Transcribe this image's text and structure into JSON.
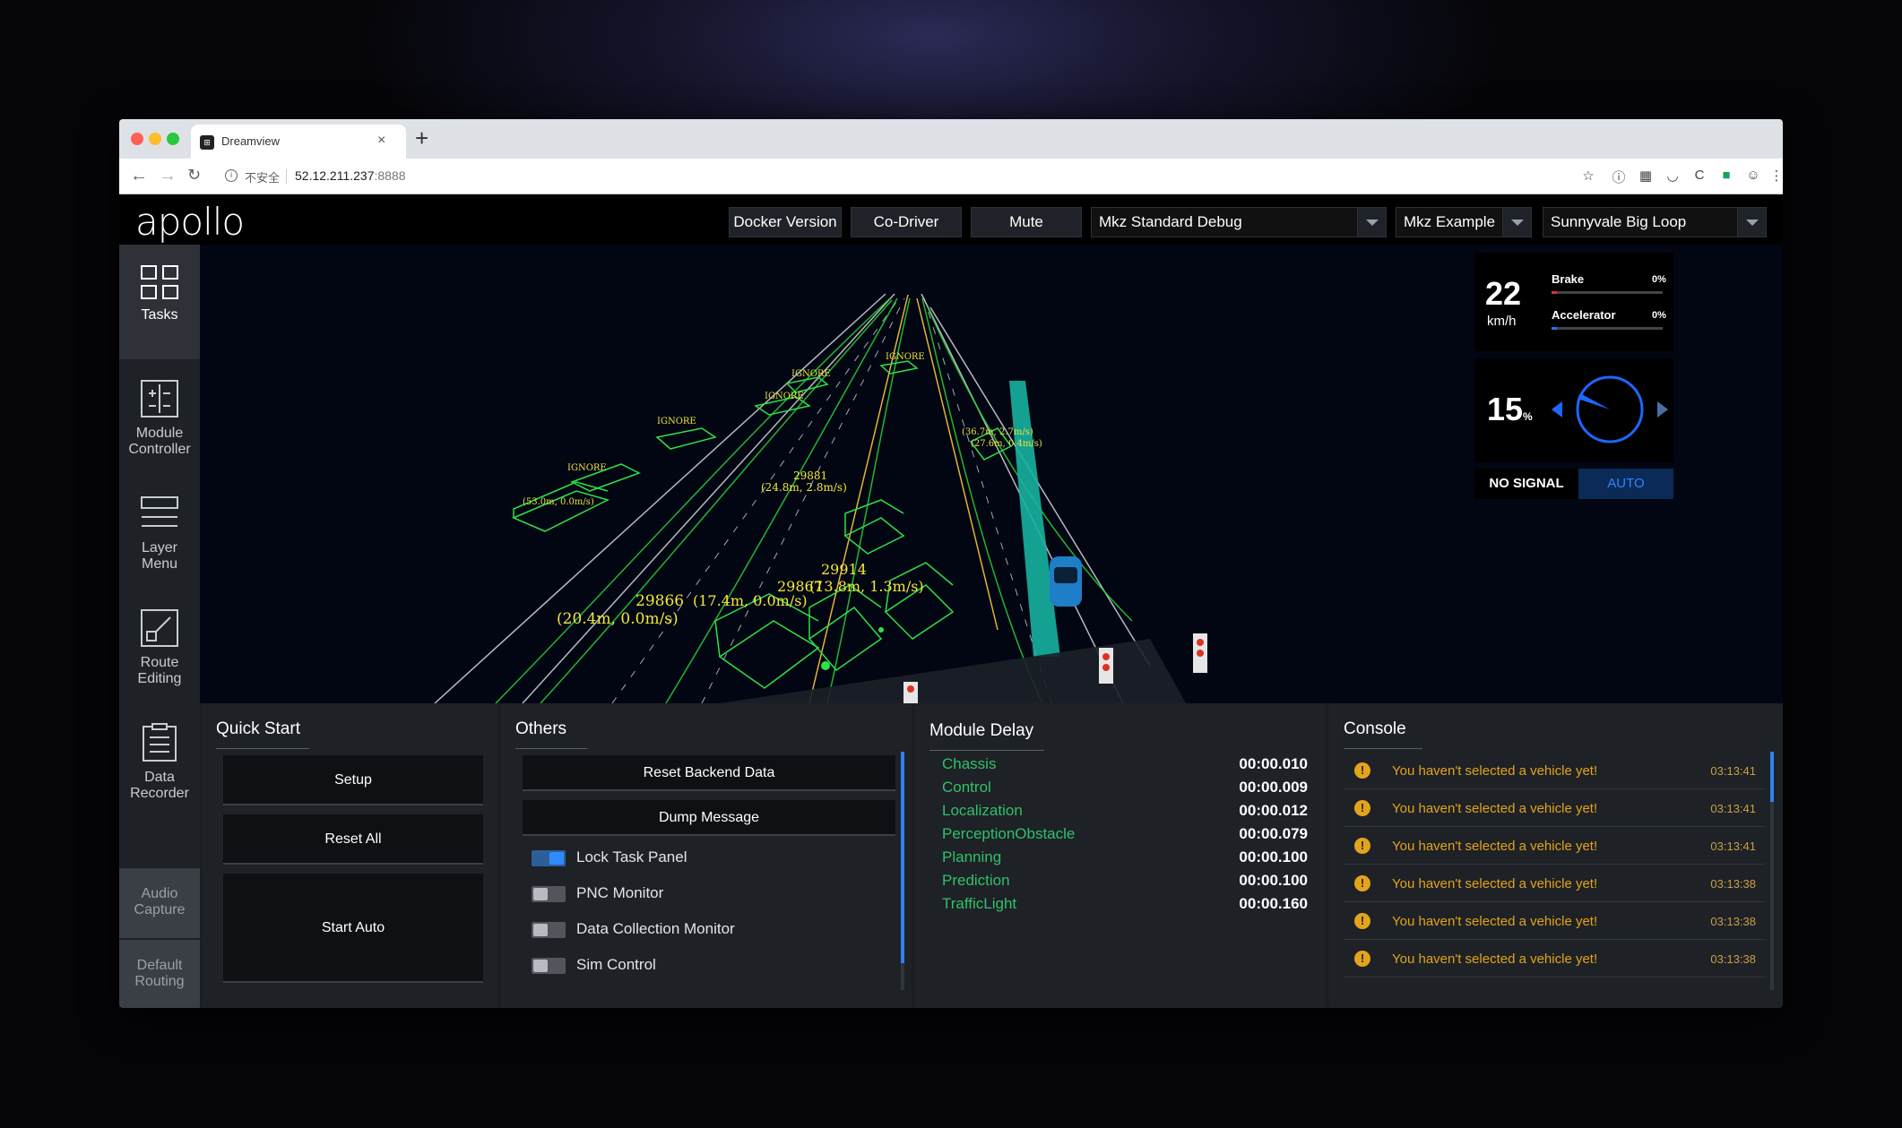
{
  "browser": {
    "tab_title": "Dreamview",
    "tab_favicon": "apollo-favicon",
    "security_label": "不安全",
    "url_host": "52.12.211.237",
    "url_port": ":8888"
  },
  "header": {
    "logo": "apollo",
    "buttons": [
      "Docker Version",
      "Co-Driver",
      "Mute"
    ],
    "mode_select": "Mkz Standard Debug",
    "vehicle_select": "Mkz Example",
    "map_select": "Sunnyvale Big Loop"
  },
  "sidebar": {
    "items": [
      {
        "label_line1": "Tasks",
        "label_line2": "",
        "icon": "grid-icon"
      },
      {
        "label_line1": "Module",
        "label_line2": "Controller",
        "icon": "module-controller-icon"
      },
      {
        "label_line1": "Layer",
        "label_line2": "Menu",
        "icon": "layer-menu-icon"
      },
      {
        "label_line1": "Route",
        "label_line2": "Editing",
        "icon": "route-editing-icon"
      },
      {
        "label_line1": "Data",
        "label_line2": "Recorder",
        "icon": "data-recorder-icon"
      }
    ],
    "footer": [
      {
        "line1": "Audio",
        "line2": "Capture"
      },
      {
        "line1": "Default",
        "line2": "Routing"
      }
    ]
  },
  "dashboard": {
    "speed": "22",
    "speed_unit": "km/h",
    "brake_label": "Brake",
    "brake_value": "0%",
    "brake_level": 0.0,
    "brake_color": "#d9342b",
    "accel_label": "Accelerator",
    "accel_value": "0%",
    "accel_level": 0.0,
    "accel_color": "#2f6dff",
    "steering_value": "15",
    "steering_unit": "%",
    "signal_label": "NO SIGNAL",
    "drive_mode": "AUTO"
  },
  "scene_labels": [
    {
      "id": "29866",
      "text1": "29866",
      "text2": "(20.4m, 0.0m/s)"
    },
    {
      "id": "29867",
      "text1": "29867",
      "text2": "(13.8m, 1.3m/s)"
    },
    {
      "id": "29914",
      "text1": "29914",
      "text2": "(17.4m, 0.0m/s)"
    },
    {
      "id": "29881",
      "text1": "29881",
      "text2": "(24.8m, 2.8m/s)"
    }
  ],
  "quick_start": {
    "title": "Quick Start",
    "buttons": [
      "Setup",
      "Reset All",
      "Start Auto"
    ]
  },
  "others": {
    "title": "Others",
    "buttons": [
      "Reset Backend Data",
      "Dump Message"
    ],
    "toggles": [
      {
        "label": "Lock Task Panel",
        "on": true
      },
      {
        "label": "PNC Monitor",
        "on": false
      },
      {
        "label": "Data Collection Monitor",
        "on": false
      },
      {
        "label": "Sim Control",
        "on": false
      }
    ]
  },
  "module_delay": {
    "title": "Module Delay",
    "rows": [
      {
        "name": "Chassis",
        "value": "00:00.010"
      },
      {
        "name": "Control",
        "value": "00:00.009"
      },
      {
        "name": "Localization",
        "value": "00:00.012"
      },
      {
        "name": "PerceptionObstacle",
        "value": "00:00.079"
      },
      {
        "name": "Planning",
        "value": "00:00.100"
      },
      {
        "name": "Prediction",
        "value": "00:00.100"
      },
      {
        "name": "TrafficLight",
        "value": "00:00.160"
      }
    ]
  },
  "console": {
    "title": "Console",
    "rows": [
      {
        "message": "You haven't selected a vehicle yet!",
        "time": "03:13:41"
      },
      {
        "message": "You haven't selected a vehicle yet!",
        "time": "03:13:41"
      },
      {
        "message": "You haven't selected a vehicle yet!",
        "time": "03:13:41"
      },
      {
        "message": "You haven't selected a vehicle yet!",
        "time": "03:13:38"
      },
      {
        "message": "You haven't selected a vehicle yet!",
        "time": "03:13:38"
      },
      {
        "message": "You haven't selected a vehicle yet!",
        "time": "03:13:38"
      }
    ]
  }
}
